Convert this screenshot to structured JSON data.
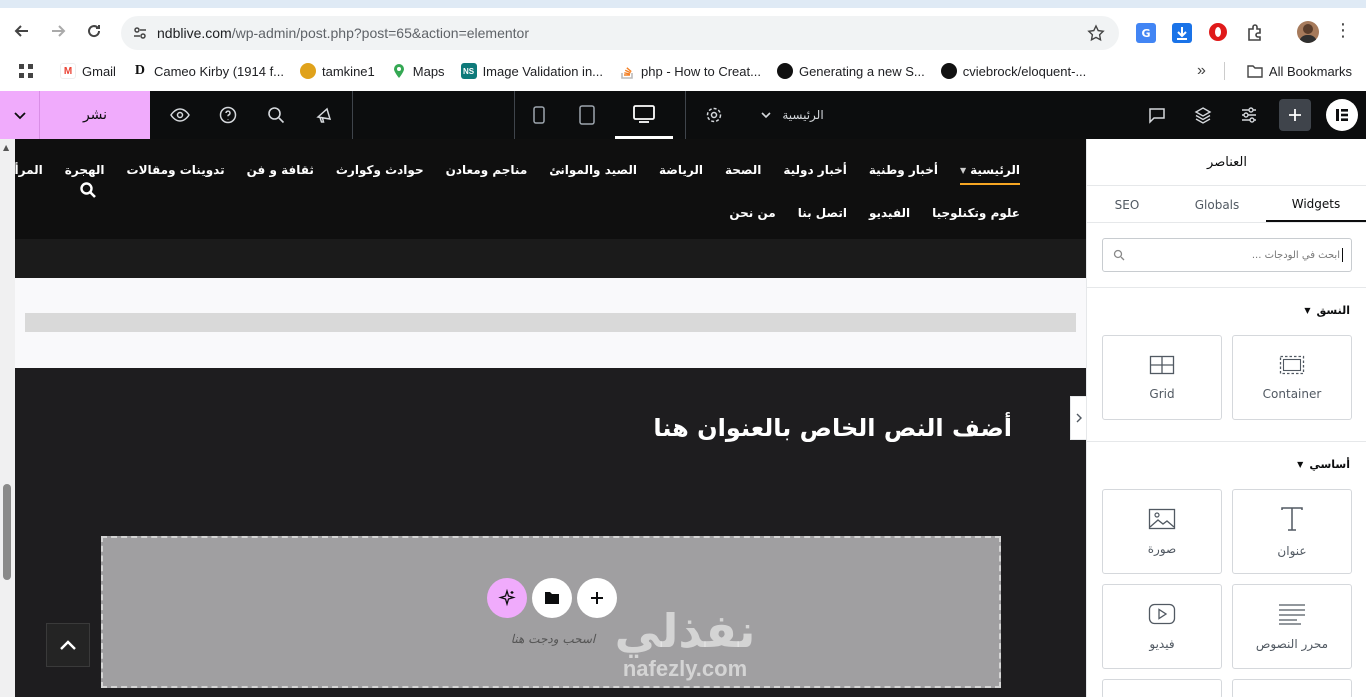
{
  "browser": {
    "url_host": "ndblive.com",
    "url_path": "/wp-admin/post.php?post=65&action=elementor",
    "bookmarks": [
      {
        "label": "Gmail",
        "icon": "gmail-icon"
      },
      {
        "label": "Cameo Kirby (1914 f...",
        "icon": "d-icon"
      },
      {
        "label": "tamkine1",
        "icon": "tamkine-icon"
      },
      {
        "label": "Maps",
        "icon": "maps-icon"
      },
      {
        "label": "Image Validation in...",
        "icon": "ns-icon"
      },
      {
        "label": "php - How to Creat...",
        "icon": "stackoverflow-icon"
      },
      {
        "label": "Generating a new S...",
        "icon": "github-icon"
      },
      {
        "label": "cviebrock/eloquent-...",
        "icon": "github-icon"
      }
    ],
    "all_bookmarks": "All Bookmarks",
    "more": "»"
  },
  "editor": {
    "publish_label": "نشر",
    "page_label": "الرئيسية",
    "accent": "#f0abfc"
  },
  "site": {
    "nav_row1": [
      "الرئيسية",
      "أخبار وطنية",
      "أخبار دولية",
      "الصحة",
      "الرياضة",
      "الصيد والموانئ",
      "مناجم ومعادن",
      "حوادث وكوارث",
      "ثقافة و فن",
      "تدوينات ومقالات",
      "الهجرة",
      "المرأة والمجتمع"
    ],
    "nav_row2": [
      "علوم وتكنلوجيا",
      "الفيديو",
      "اتصل بنا",
      "من نحن"
    ],
    "heading": "أضف النص الخاص بالعنوان هنا",
    "drop_hint": "اسحب ودجت هنا"
  },
  "panel": {
    "title": "العناصر",
    "tabs": [
      "Widgets",
      "Globals",
      "SEO"
    ],
    "search_placeholder": "ابحث في الودجات ...",
    "category_layout": "النسق",
    "category_basic": "أساسي",
    "layout_widgets": [
      "Container",
      "Grid"
    ],
    "basic_widgets": [
      "عنوان",
      "صورة",
      "محرر النصوص",
      "فيديو"
    ]
  },
  "watermark": {
    "text_ar": "نفذلي",
    "text_en": "nafezly.com"
  }
}
